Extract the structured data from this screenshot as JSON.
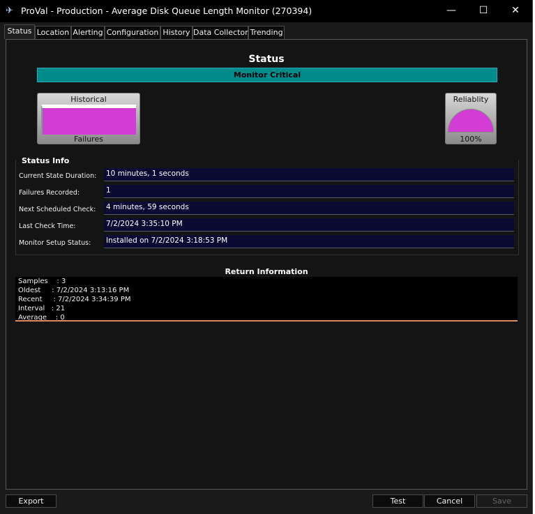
{
  "window": {
    "title": "ProVal - Production - Average Disk Queue Length Monitor (270394)",
    "controls": {
      "minimize": "—",
      "maximize": "☐",
      "close": "✕"
    }
  },
  "tabs": [
    {
      "label": "Status",
      "active": true
    },
    {
      "label": "Location"
    },
    {
      "label": "Alerting"
    },
    {
      "label": "Configuration"
    },
    {
      "label": "History"
    },
    {
      "label": "Data Collector"
    },
    {
      "label": "Trending"
    }
  ],
  "status": {
    "title": "Status",
    "state": "Monitor Critical",
    "state_color": "#008b8b"
  },
  "gauges": {
    "historical": {
      "title": "Historical",
      "caption": "Failures",
      "fill_color": "#d33dd6"
    },
    "reliability": {
      "title": "Reliablity",
      "value": "100%",
      "fill_color": "#d33dd6"
    }
  },
  "status_info": {
    "title": "Status Info",
    "rows": [
      {
        "label": "Current State Duration:",
        "value": "10 minutes, 1 seconds"
      },
      {
        "label": "Failures Recorded:",
        "value": "1"
      },
      {
        "label": "Next Scheduled Check:",
        "value": "4 minutes, 59 seconds"
      },
      {
        "label": "Last Check Time:",
        "value": "7/2/2024 3:35:10 PM"
      },
      {
        "label": "Monitor Setup Status:",
        "value": "Installed on 7/2/2024 3:18:53 PM"
      }
    ]
  },
  "return_info": {
    "title": "Return Information",
    "lines": [
      "Samples    : 3",
      "Oldest     : 7/2/2024 3:13:16 PM",
      "Recent     : 7/2/2024 3:34:39 PM",
      "Interval   : 21",
      "Average    : 0"
    ]
  },
  "buttons": {
    "export": "Export",
    "test": "Test",
    "cancel": "Cancel",
    "save": "Save"
  }
}
